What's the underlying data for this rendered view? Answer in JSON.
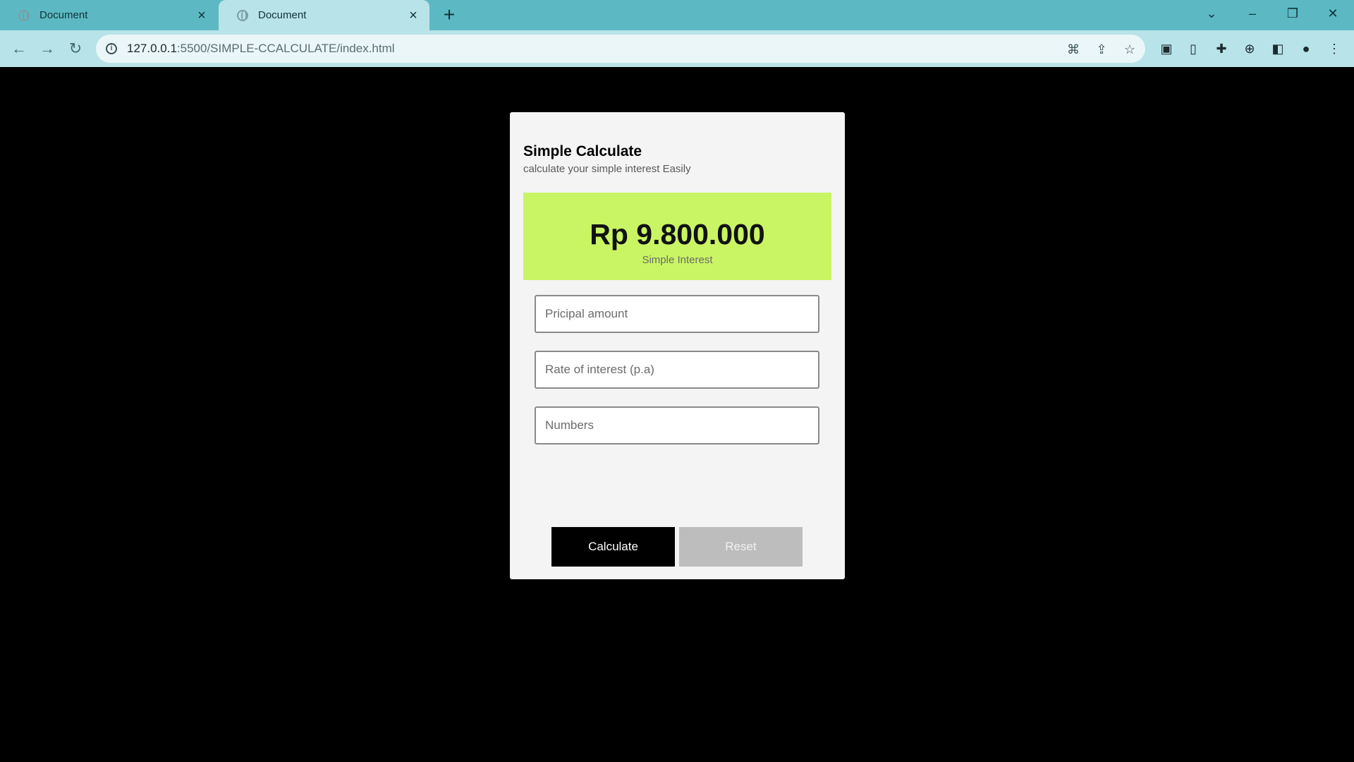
{
  "browser": {
    "tabs": [
      {
        "title": "Document",
        "active": false
      },
      {
        "title": "Document",
        "active": true
      }
    ],
    "url_host": "127.0.0.1",
    "url_rest": ":5500/SIMPLE-CCALCULATE/index.html",
    "colors": {
      "tabbar": "#5cb9c3",
      "toolbar": "#b8e3e8"
    }
  },
  "app": {
    "title": "Simple Calculate",
    "subtitle": "calculate your simple interest Easily",
    "result_amount": "Rp 9.800.000",
    "result_label": "Simple Interest",
    "inputs": {
      "principal_placeholder": "Pricipal amount",
      "rate_placeholder": "Rate of interest (p.a)",
      "numbers_placeholder": "Numbers"
    },
    "buttons": {
      "calculate": "Calculate",
      "reset": "Reset"
    },
    "colors": {
      "result_bg": "#c9f564",
      "page_bg": "#000000",
      "card_bg": "#f4f4f4"
    }
  }
}
